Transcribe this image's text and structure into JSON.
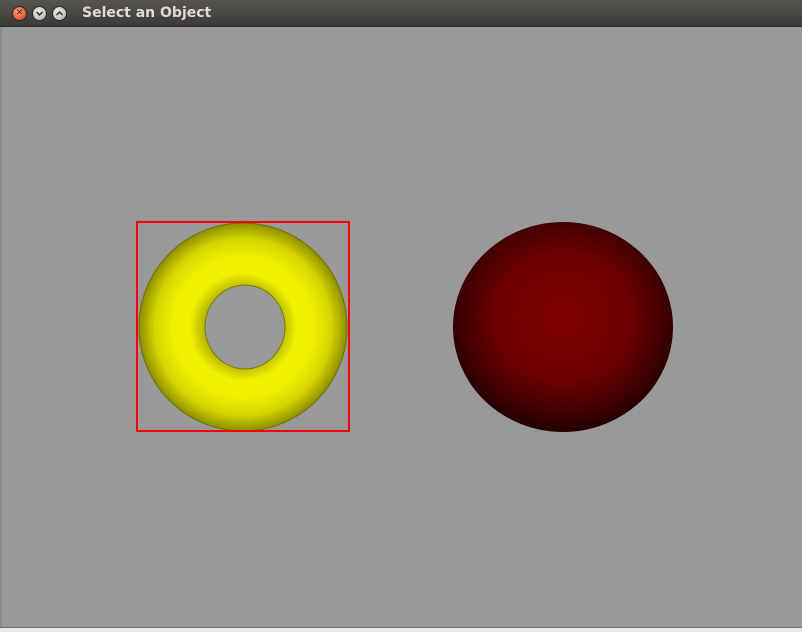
{
  "window": {
    "title": "Select an Object",
    "buttons": {
      "close_icon": "close-icon",
      "minimize_icon": "chevron-down-icon",
      "maximize_icon": "chevron-up-icon"
    }
  },
  "scene": {
    "background_color": "#999999",
    "objects": [
      {
        "kind": "torus",
        "color": "#f0f000",
        "selected": true
      },
      {
        "kind": "sphere",
        "color": "#7a0000",
        "selected": false
      }
    ],
    "selection_color": "#ff0000"
  }
}
